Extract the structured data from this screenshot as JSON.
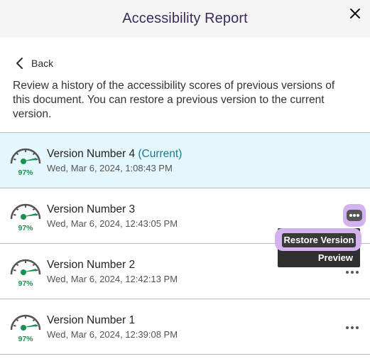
{
  "header": {
    "title": "Accessibility Report",
    "close_icon": "close-icon"
  },
  "nav": {
    "back_label": "Back",
    "back_icon": "chevron-left-icon"
  },
  "description": "Review a history of the accessibility scores of previous versions of this document. You can restore a previous version to the current version.",
  "colors": {
    "accent": "#3b2c5c",
    "current_bg": "#e4f7fc",
    "current_tag": "#197a8f",
    "score_green": "#19914f",
    "focus_ring": "#d3b2ef"
  },
  "versions": [
    {
      "name": "Version Number 4",
      "current_tag": "(Current)",
      "date": "Wed, Mar 6, 2024, 1:08:43 PM",
      "score": "97%"
    },
    {
      "name": "Version Number 3",
      "current_tag": "",
      "date": "Wed, Mar 6, 2024, 12:43:05 PM",
      "score": "97%"
    },
    {
      "name": "Version Number 2",
      "current_tag": "",
      "date": "Wed, Mar 6, 2024, 12:42:13 PM",
      "score": "97%"
    },
    {
      "name": "Version Number 1",
      "current_tag": "",
      "date": "Wed, Mar 6, 2024, 12:39:08 PM",
      "score": "97%"
    }
  ],
  "context_menu": {
    "restore_label": "Restore Version",
    "preview_label": "Preview"
  }
}
